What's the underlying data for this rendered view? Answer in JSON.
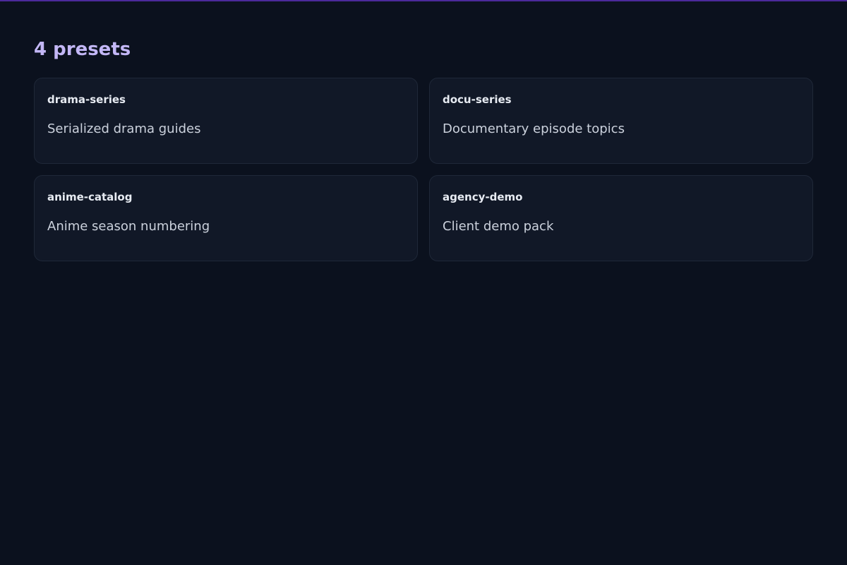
{
  "page": {
    "title": "4 presets"
  },
  "presets": [
    {
      "name": "drama-series",
      "description": "Serialized drama guides"
    },
    {
      "name": "docu-series",
      "description": "Documentary episode topics"
    },
    {
      "name": "anime-catalog",
      "description": "Anime season numbering"
    },
    {
      "name": "agency-demo",
      "description": "Client demo pack"
    }
  ],
  "colors": {
    "background": "#0b111e",
    "card": "#111827",
    "card_border": "#1f2838",
    "title": "#c3b7f6",
    "accent_line": "#4c2a9b"
  }
}
